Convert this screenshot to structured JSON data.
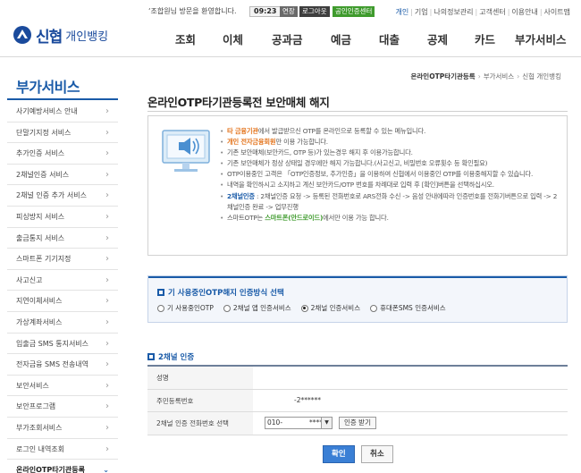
{
  "topbar": {
    "welcome": "‘조합원님 방문을 환영합니다.",
    "time": "09:23",
    "extend_label": "연장",
    "logout_label": "로그아웃",
    "cert_center_label": "공인인증센터",
    "links": [
      "개인",
      "기업",
      "나의정보관리",
      "고객센터",
      "이용안내",
      "사이트맵"
    ]
  },
  "brand": {
    "name": "신협",
    "sub": "개인뱅킹"
  },
  "gnb": [
    "조회",
    "이체",
    "공과금",
    "예금",
    "대출",
    "공제",
    "카드",
    "부가서비스"
  ],
  "sidebar": {
    "title": "부가서비스",
    "items": [
      "사기예방서비스 안내",
      "단말기지정 서비스",
      "추가인증 서비스",
      "2채널인증 서비스",
      "2채널 인증 추가 서비스",
      "피싱방지 서비스",
      "출금통지 서비스",
      "스마트폰 기기지정",
      "사고신고",
      "지연이체서비스",
      "가상계좌서비스",
      "입출금 SMS 통지서비스",
      "전자금융 SMS 전송내역",
      "보안서비스",
      "보안프로그램",
      "부가조회서비스",
      "로그인 내역조회",
      "온라인OTP타기관등록"
    ],
    "active_index": 17
  },
  "breadcrumb": {
    "current": "온라인OTP타기관등록",
    "parent": "부가서비스",
    "root": "신협 개인뱅킹"
  },
  "page_title": "온라인OTP타기관등록전 보안매체 해지",
  "notes": {
    "n1_hl": "타 금융기관",
    "n1_rest": "에서 발급받으신 OTP를 온라인으로 등록할 수 있는 메뉴입니다.",
    "n2_hl": "개인 전자금융회원",
    "n2_rest": "만 이용 가능합니다.",
    "n3": "기존 보안매체(보안카드, OTP 등)가 있는경우 해지 후 이용가능합니다.",
    "n4": "기존 보안매체가 정상 상태일 경우에만 해지 가능합니다.(사고신고, 비밀번호 오류횟수 등 확인필요)",
    "n5": "OTP이용중인 고객은 「OTP인증정보, 추가인증」을 이용하여 신협에서 이용중인 OTP를 이용중해지할 수 있습니다.",
    "n6": "내역을 확인하시고 소지하고 계신 보안카드/OTP 번호를 차례대로 입력 후 [확인]버튼을 선택하십시오.",
    "n7_hl": "2채널인증",
    "n7_rest": " : 2채널인증 요청 -> 등록된 전화번호로 ARS전화 수신 -> 음성 안내에따라 인증번호를 전화기버튼으로 입력 -> 2채널인증 완료 -> 업무진행",
    "n8_pre": "스마트OTP는 ",
    "n8_hl": "스마트폰(안드로이드)",
    "n8_rest": "에서만 이용 가능 합니다."
  },
  "method": {
    "heading": "기 사용중인OTP해지 인증방식 선택",
    "options": [
      "기 사용중인OTP",
      "2채널 앱 인증서비스",
      "2채널 인증서비스",
      "휴대폰SMS 인증서비스"
    ],
    "selected_index": 2
  },
  "auth": {
    "heading": "2채널 인증",
    "rows": {
      "name_label": "성명",
      "name_value": "",
      "id_label": "주민등록번호",
      "id_value": "-2******",
      "phone_label": "2채널 인증 전화번호 선택",
      "phone_prefix": "010-",
      "phone_mask": "****",
      "cert_button": "인증 받기"
    }
  },
  "buttons": {
    "confirm": "확인",
    "cancel": "취소"
  },
  "colors": {
    "brand_blue": "#1a5ba8",
    "highlight_orange": "#e3731b",
    "highlight_green": "#3f9b2d",
    "cert_green": "#3f9b2d"
  }
}
